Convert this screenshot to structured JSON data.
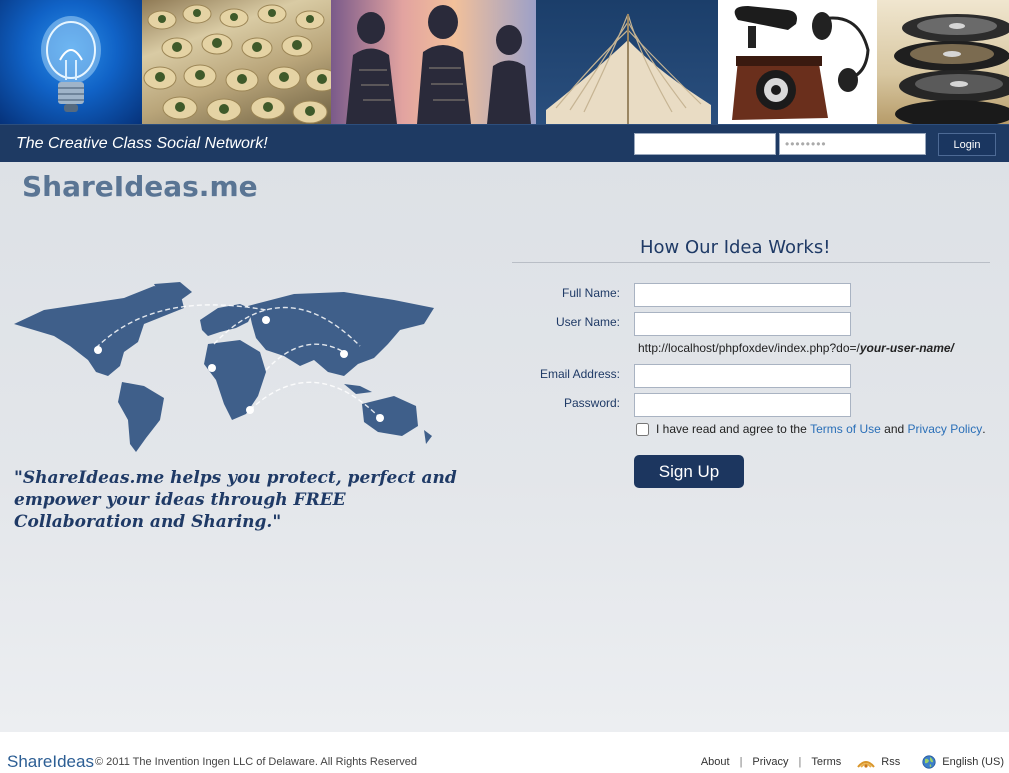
{
  "header": {
    "tagline": "The Creative Class Social Network!",
    "login_password_placeholder": "••••••••",
    "login_button": "Login"
  },
  "site_title": "ShareIdeas.me",
  "quote": "\"ShareIdeas.me helps you protect, perfect and empower your ideas through FREE Collaboration and Sharing.\"",
  "signup": {
    "heading": "How Our Idea Works!",
    "full_name_label": "Full Name:",
    "user_name_label": "User Name:",
    "url_prefix": "http://localhost/phpfoxdev/index.php?do=/",
    "url_placeholder": "your-user-name/",
    "email_label": "Email Address:",
    "password_label": "Password:",
    "agree_text_1": "I have read and agree to the",
    "terms_link": "Terms of Use",
    "agree_and": "and",
    "privacy_link": "Privacy Policy",
    "agree_end": ".",
    "signup_button": "Sign Up"
  },
  "footer": {
    "logo": "ShareIdeas",
    "copyright": "© 2011 The Invention Ingen LLC of Delaware. All Rights Reserved",
    "links": [
      "About",
      "Privacy",
      "Terms"
    ],
    "rss": "Rss",
    "language": "English (US)"
  },
  "icons": {
    "rss": "rss-icon",
    "globe": "globe-icon"
  },
  "colors": {
    "navbar": "#1e3a63",
    "accent": "#1f3a66",
    "link": "#2a6fb8"
  }
}
